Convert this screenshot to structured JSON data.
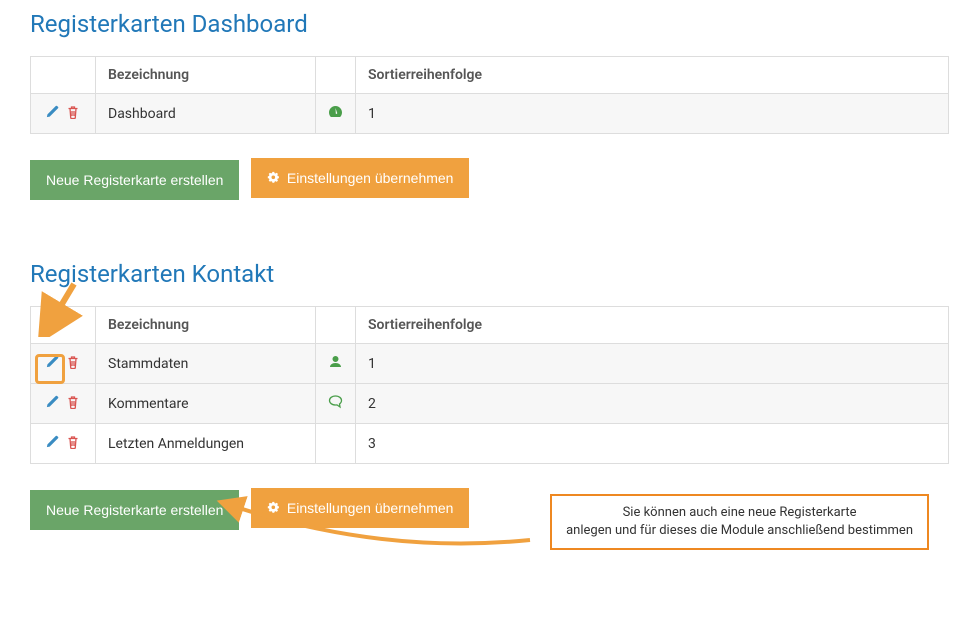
{
  "sections": [
    {
      "title": "Registerkarten Dashboard",
      "headers": {
        "bezeichnung": "Bezeichnung",
        "sort": "Sortierreihenfolge"
      },
      "rows": [
        {
          "name": "Dashboard",
          "icon": "dashboard",
          "iconColor": "#4a9e4a",
          "sort": "1"
        }
      ]
    },
    {
      "title": "Registerkarten Kontakt",
      "headers": {
        "bezeichnung": "Bezeichnung",
        "sort": "Sortierreihenfolge"
      },
      "rows": [
        {
          "name": "Stammdaten",
          "icon": "user",
          "iconColor": "#4a9e4a",
          "sort": "1"
        },
        {
          "name": "Kommentare",
          "icon": "comment",
          "iconColor": "#4a9e4a",
          "sort": "2"
        },
        {
          "name": "Letzten Anmeldungen",
          "icon": "",
          "iconColor": "",
          "sort": "3"
        }
      ]
    }
  ],
  "buttons": {
    "create": "Neue Registerkarte erstellen",
    "apply": "Einstellungen übernehmen"
  },
  "callout": "Sie können auch eine neue Registerkarte\nanlegen und für dieses die Module anschließend bestimmen"
}
